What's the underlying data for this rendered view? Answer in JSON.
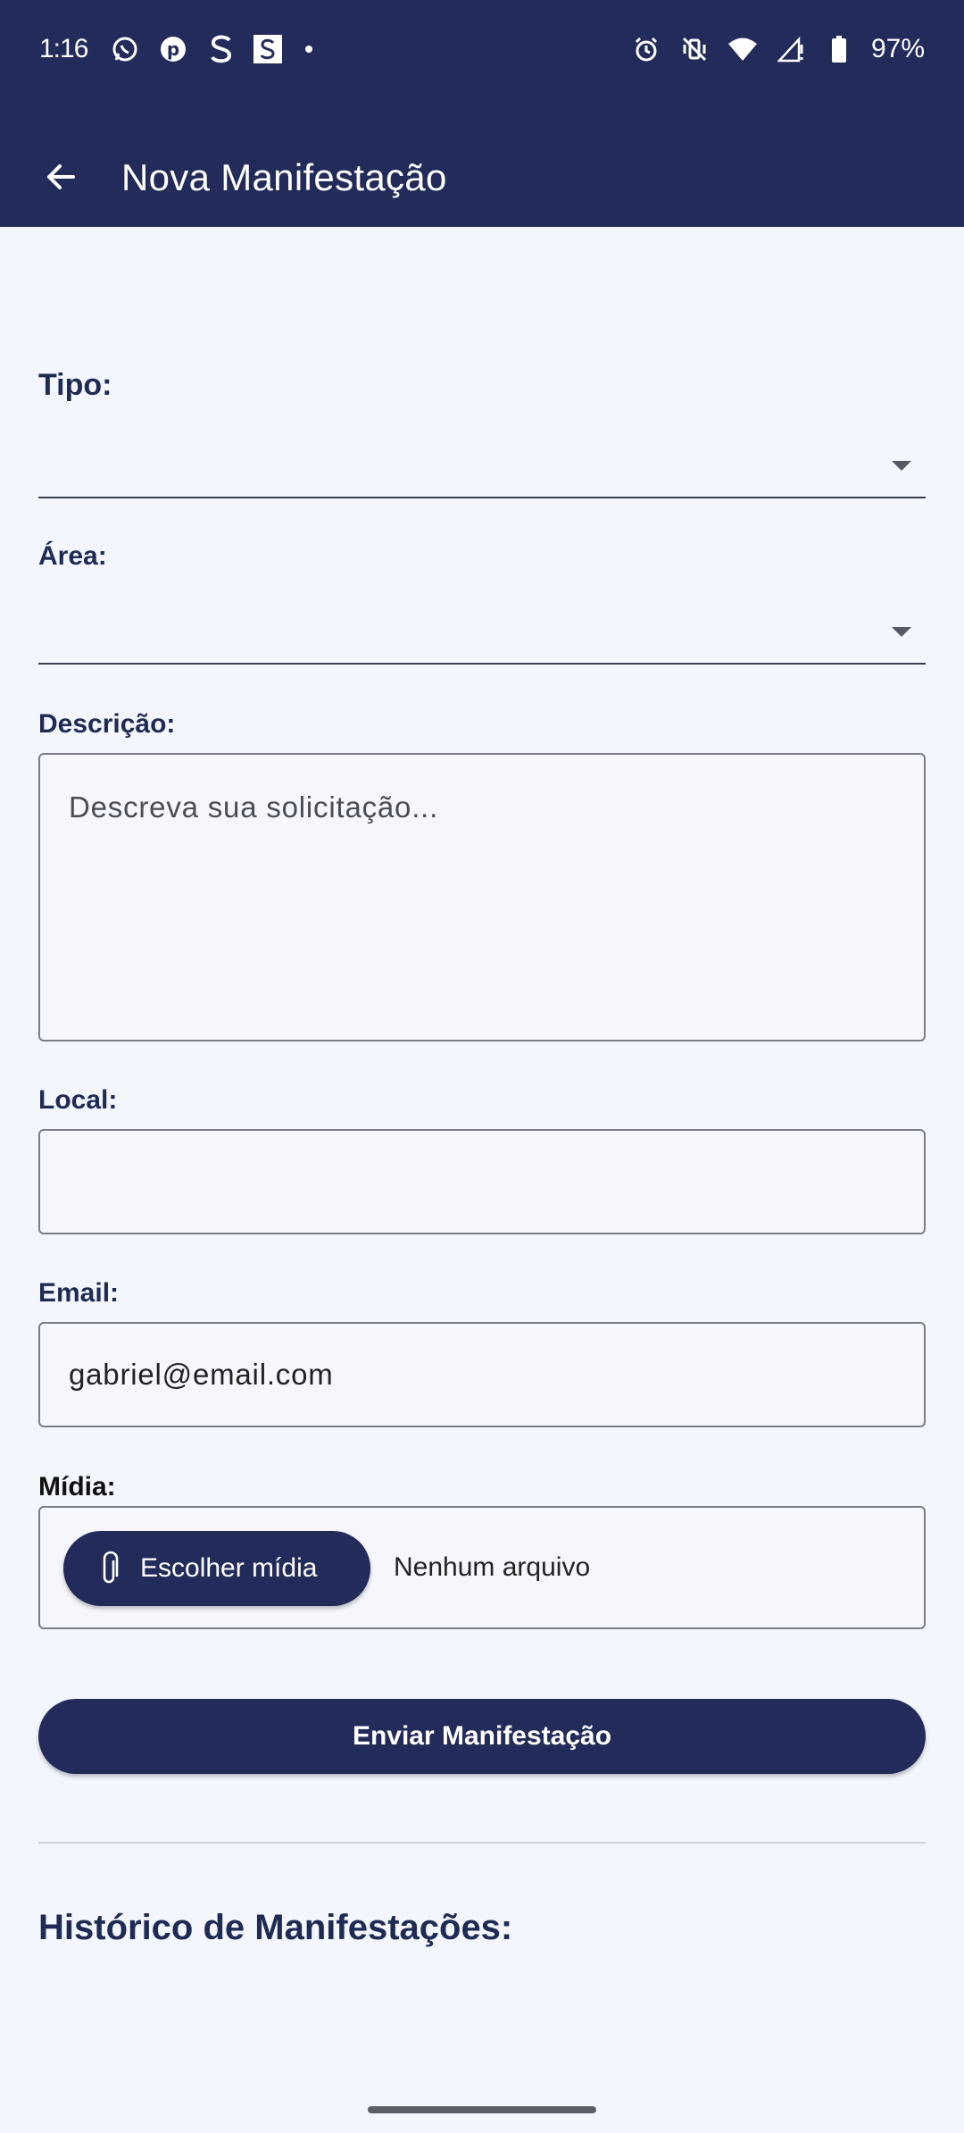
{
  "status_bar": {
    "time": "1:16",
    "notification_icons": [
      "whatsapp-icon",
      "pinterest-icon",
      "s-app-icon",
      "s-box-app-icon"
    ],
    "system_icons": [
      "alarm-icon",
      "vibrate-off-icon",
      "wifi-icon",
      "signal-icon",
      "battery-icon"
    ],
    "battery": "97%"
  },
  "app_bar": {
    "title": "Nova Manifestação",
    "background": "#232b5a"
  },
  "form": {
    "tipo_label": "Tipo:",
    "tipo_value": "",
    "area_label": "Área:",
    "area_value": "",
    "descricao_label": "Descrição:",
    "descricao_placeholder": "Descreva sua solicitação...",
    "local_label": "Local:",
    "local_value": "",
    "email_label": "Email:",
    "email_value": "gabriel@email.com",
    "midia_label": "Mídia:",
    "midia_button": "Escolher mídia",
    "midia_status": "Nenhum arquivo",
    "submit_label": "Enviar Manifestação"
  },
  "history": {
    "title": "Histórico de Manifestações:"
  },
  "colors": {
    "primary": "#232b5a",
    "background": "#f3f6fd"
  }
}
